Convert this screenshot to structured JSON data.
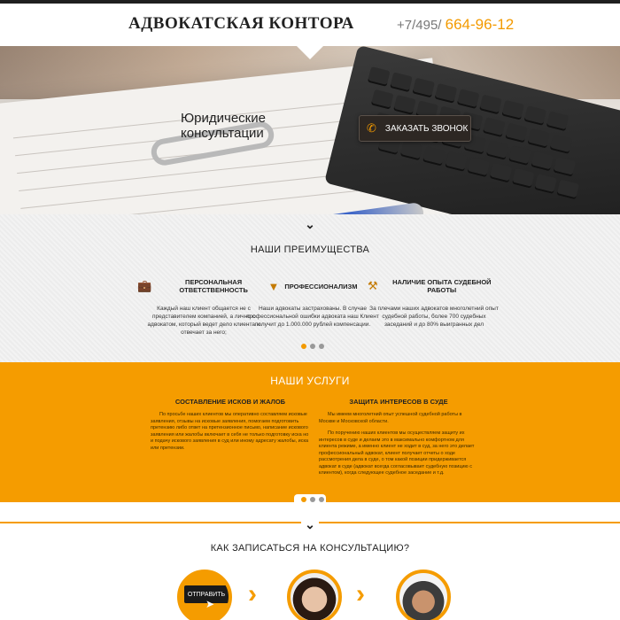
{
  "header": {
    "logo": "АДВОКАТСКАЯ КОНТОРА",
    "phone_prefix": "+7/495/",
    "phone_number": "664-96-12"
  },
  "hero": {
    "title": "Юридические консультации",
    "cta_label": "ЗАКАЗАТЬ ЗВОНОК"
  },
  "advantages": {
    "title": "НАШИ ПРЕИМУЩЕСТВА",
    "items": [
      {
        "icon": "briefcase-icon",
        "title": "ПЕРСОНАЛЬНАЯ ОТВЕТСТВЕННОСТЬ",
        "text": "Каждый наш клиент общается не с представителем компанией, а лично с адвокатом, который ведет дело клиента и отвечает за него;"
      },
      {
        "icon": "tie-icon",
        "title": "ПРОФЕССИОНАЛИЗМ",
        "text": "Наши адвокаты застрахованы. В случае профессиональной ошибки адвоката наш Клиент получит до 1.000.000 рублей компенсации."
      },
      {
        "icon": "gavel-icon",
        "title": "НАЛИЧИЕ ОПЫТА СУДЕБНОЙ РАБОТЫ",
        "text": "За плечами наших адвокатов многолетний опыт судебной работы, более 700 судебных заседаний и до 80% выигранных дел"
      }
    ]
  },
  "services": {
    "title": "НАШИ УСЛУГИ",
    "columns": [
      {
        "title": "СОСТАВЛЕНИЕ ИСКОВ И ЖАЛОБ",
        "paragraphs": [
          "По просьбе наших клиентов мы оперативно составляем исковые заявления, отзывы на исковые заявления, помогаем подготовить претензию либо ответ на претензионное письмо, написание искового заявления или жалобы включает в себя не только подготовку иска но и подачу искового заявления в суд или иному адресату жалобы, иска или претензии."
        ]
      },
      {
        "title": "ЗАЩИТА ИНТЕРЕСОВ В СУДЕ",
        "paragraphs": [
          "Мы имеем многолетний опыт успешной судебной работы в Москве и Московской области.",
          "По поручению наших клиентов мы осуществляем защиту их интересов в суде и делаем это в максимально комфортном для клиента режиме, а именно клиент не ходит в суд, за него это делает профессиональный адвокат, клиент получает отчеты о ходе рассмотрения дела в суде, о том какой позиции придерживается адвокат в суде (адвокат всегда согласовывает судебную позицию с клиентом), когда следующее судебное заседание и т.д."
        ]
      }
    ]
  },
  "consultation": {
    "title": "КАК ЗАПИСАТЬСЯ НА КОНСУЛЬТАЦИЮ?",
    "send_label": "ОТПРАВИТЬ"
  },
  "colors": {
    "accent": "#f59c00",
    "dark": "#1f1f1f"
  }
}
